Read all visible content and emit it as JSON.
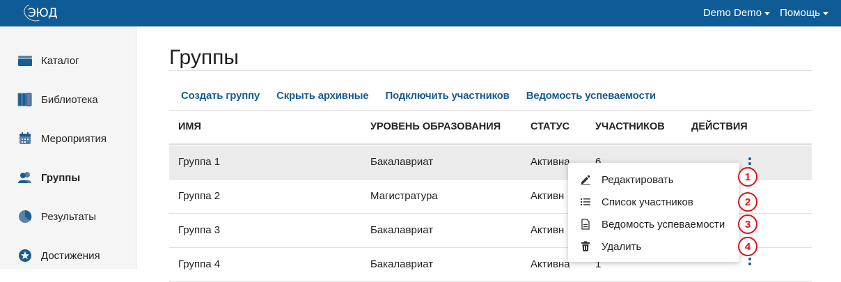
{
  "header": {
    "logo_text": "ЭЮД",
    "user_menu": "Demo Demo",
    "help_menu": "Помощь"
  },
  "sidebar": {
    "items": [
      {
        "label": "Каталог",
        "icon": "catalog-icon"
      },
      {
        "label": "Библиотека",
        "icon": "library-icon"
      },
      {
        "label": "Мероприятия",
        "icon": "calendar-icon"
      },
      {
        "label": "Группы",
        "icon": "users-icon",
        "active": true
      },
      {
        "label": "Результаты",
        "icon": "pie-chart-icon"
      },
      {
        "label": "Достижения",
        "icon": "star-icon"
      }
    ]
  },
  "main": {
    "title": "Группы",
    "actions": [
      "Создать группу",
      "Скрыть архивные",
      "Подключить участников",
      "Ведомость успеваемости"
    ],
    "table": {
      "columns": [
        "ИМЯ",
        "УРОВЕНЬ ОБРАЗОВАНИЯ",
        "СТАТУС",
        "УЧАСТНИКОВ",
        "ДЕЙСТВИЯ"
      ],
      "rows": [
        {
          "name": "Группа 1",
          "level": "Бакалавриат",
          "status": "Активна",
          "count": "6"
        },
        {
          "name": "Группа 2",
          "level": "Магистратура",
          "status": "Активн",
          "count": ""
        },
        {
          "name": "Группа 3",
          "level": "Бакалавриат",
          "status": "Активн",
          "count": ""
        },
        {
          "name": "Группа 4",
          "level": "Бакалавриат",
          "status": "Активна",
          "count": "1"
        }
      ]
    }
  },
  "context_menu": {
    "items": [
      {
        "label": "Редактировать",
        "icon": "edit-icon",
        "badge": "1"
      },
      {
        "label": "Список участников",
        "icon": "list-icon",
        "badge": "2"
      },
      {
        "label": "Ведомость успеваемости",
        "icon": "document-icon",
        "badge": "3"
      },
      {
        "label": "Удалить",
        "icon": "trash-icon",
        "badge": "4"
      }
    ]
  },
  "colors": {
    "header_bg": "#0f5b96",
    "link": "#1a5c8f",
    "badge": "#d9141b",
    "row_highlight": "#ebebeb"
  }
}
